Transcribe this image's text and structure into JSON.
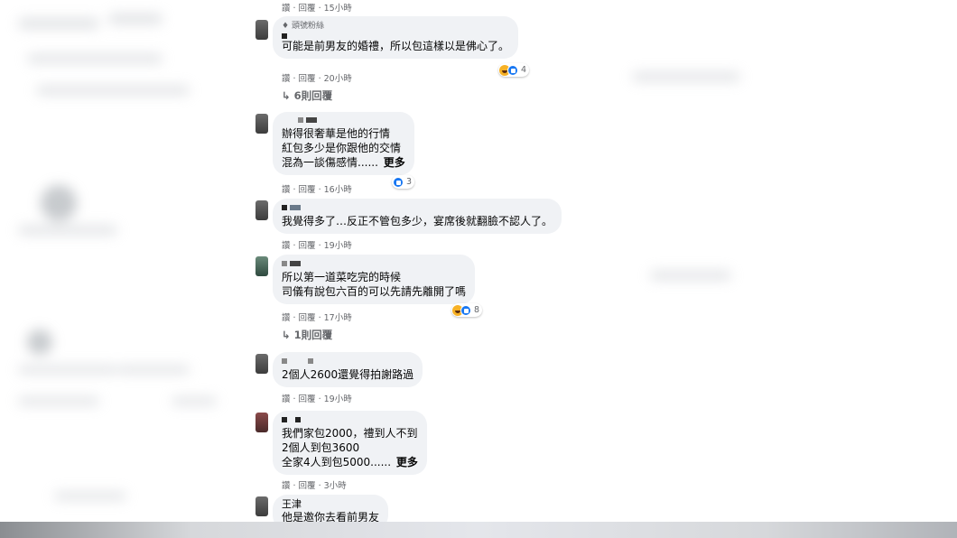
{
  "comments": [
    {
      "meta": "讚 · 回覆 · 15小時"
    },
    {
      "badge": "頭號粉絲",
      "lines": [
        "可能是前男友的婚禮，所以包這樣以是佛心了。"
      ],
      "reactions": {
        "icons": [
          "haha-icon",
          "like-icon"
        ],
        "count": "4"
      },
      "meta": "讚 · 回覆 · 20小時",
      "replies": "6則回覆"
    },
    {
      "lines": [
        "辦得很奢華是他的行情",
        "紅包多少是你跟他的交情",
        "混為一談傷感情......"
      ],
      "more": "更多",
      "reactions": {
        "icons": [
          "like-icon"
        ],
        "count": "3"
      },
      "meta": "讚 · 回覆 · 16小時"
    },
    {
      "lines": [
        "我覺得多了…反正不管包多少，宴席後就翻臉不認人了。"
      ],
      "meta": "讚 · 回覆 · 19小時"
    },
    {
      "lines": [
        "所以第一道菜吃完的時候",
        "司儀有說包六百的可以先請先離開了嗎"
      ],
      "reactions": {
        "icons": [
          "haha-icon",
          "like-icon"
        ],
        "count": "8"
      },
      "meta": "讚 · 回覆 · 17小時",
      "replies": "1則回覆"
    },
    {
      "lines": [
        "2個人2600還覺得拍謝路過"
      ],
      "meta": "讚 · 回覆 · 19小時"
    },
    {
      "lines": [
        "我們家包2000，禮到人不到",
        "2個人到包3600",
        "全家4人到包5000......"
      ],
      "more": "更多",
      "meta": "讚 · 回覆 · 3小時"
    },
    {
      "author": "王津",
      "lines": [
        "他是邀你去看前男友"
      ]
    }
  ],
  "colors": {
    "bubble": "#f0f2f5",
    "meta": "#65676b",
    "text": "#050505",
    "like": "#1877f2",
    "haha": "#f7b125"
  }
}
